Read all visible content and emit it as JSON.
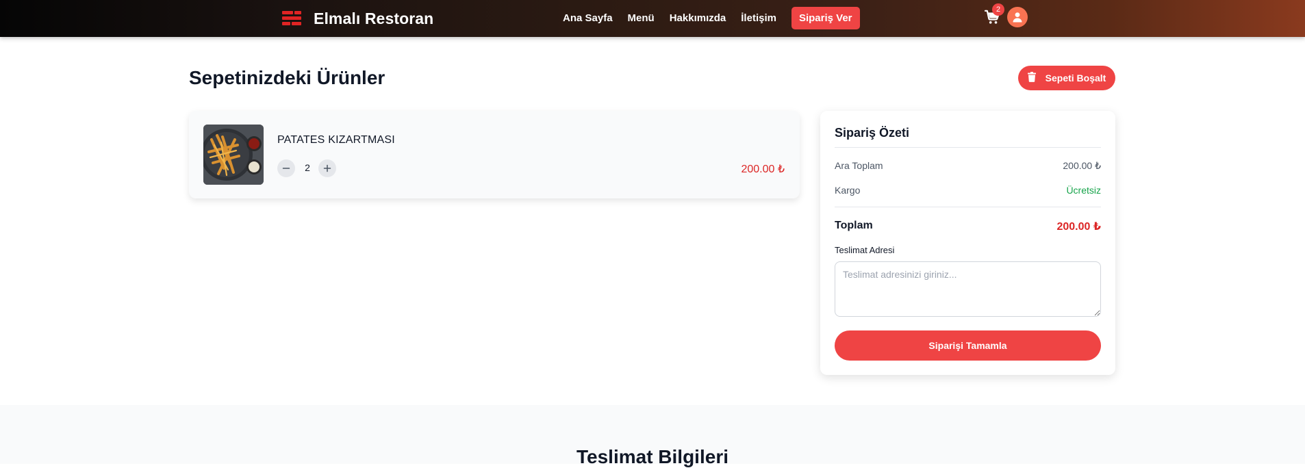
{
  "navbar": {
    "brand_title": "Elmalı Restoran",
    "links": [
      "Ana Sayfa",
      "Menü",
      "Hakkımızda",
      "İletişim"
    ],
    "cta_label": "Sipariş Ver",
    "cart_count": "2",
    "icons": {
      "logo": "restaurant-logo-icon",
      "cart": "cart-icon",
      "user": "user-icon"
    }
  },
  "page": {
    "title": "Sepetinizdeki Ürünler",
    "clear_button": "Sepeti Boşalt"
  },
  "cart": {
    "items": [
      {
        "name": "PATATES KIZARTMASI",
        "quantity": "2",
        "price": "200.00 ₺"
      }
    ]
  },
  "summary": {
    "title": "Sipariş Özeti",
    "subtotal_label": "Ara Toplam",
    "subtotal_value": "200.00 ₺",
    "shipping_label": "Kargo",
    "shipping_value": "Ücretsiz",
    "total_label": "Toplam",
    "total_value": "200.00 ₺",
    "address_label": "Teslimat Adresi",
    "address_placeholder": "Teslimat adresinizi giriniz...",
    "submit_label": "Siparişi Tamamla"
  },
  "delivery": {
    "title": "Teslimat Bilgileri"
  },
  "colors": {
    "accent": "#ef4444",
    "price": "#dc2626",
    "free": "#16a34a"
  }
}
